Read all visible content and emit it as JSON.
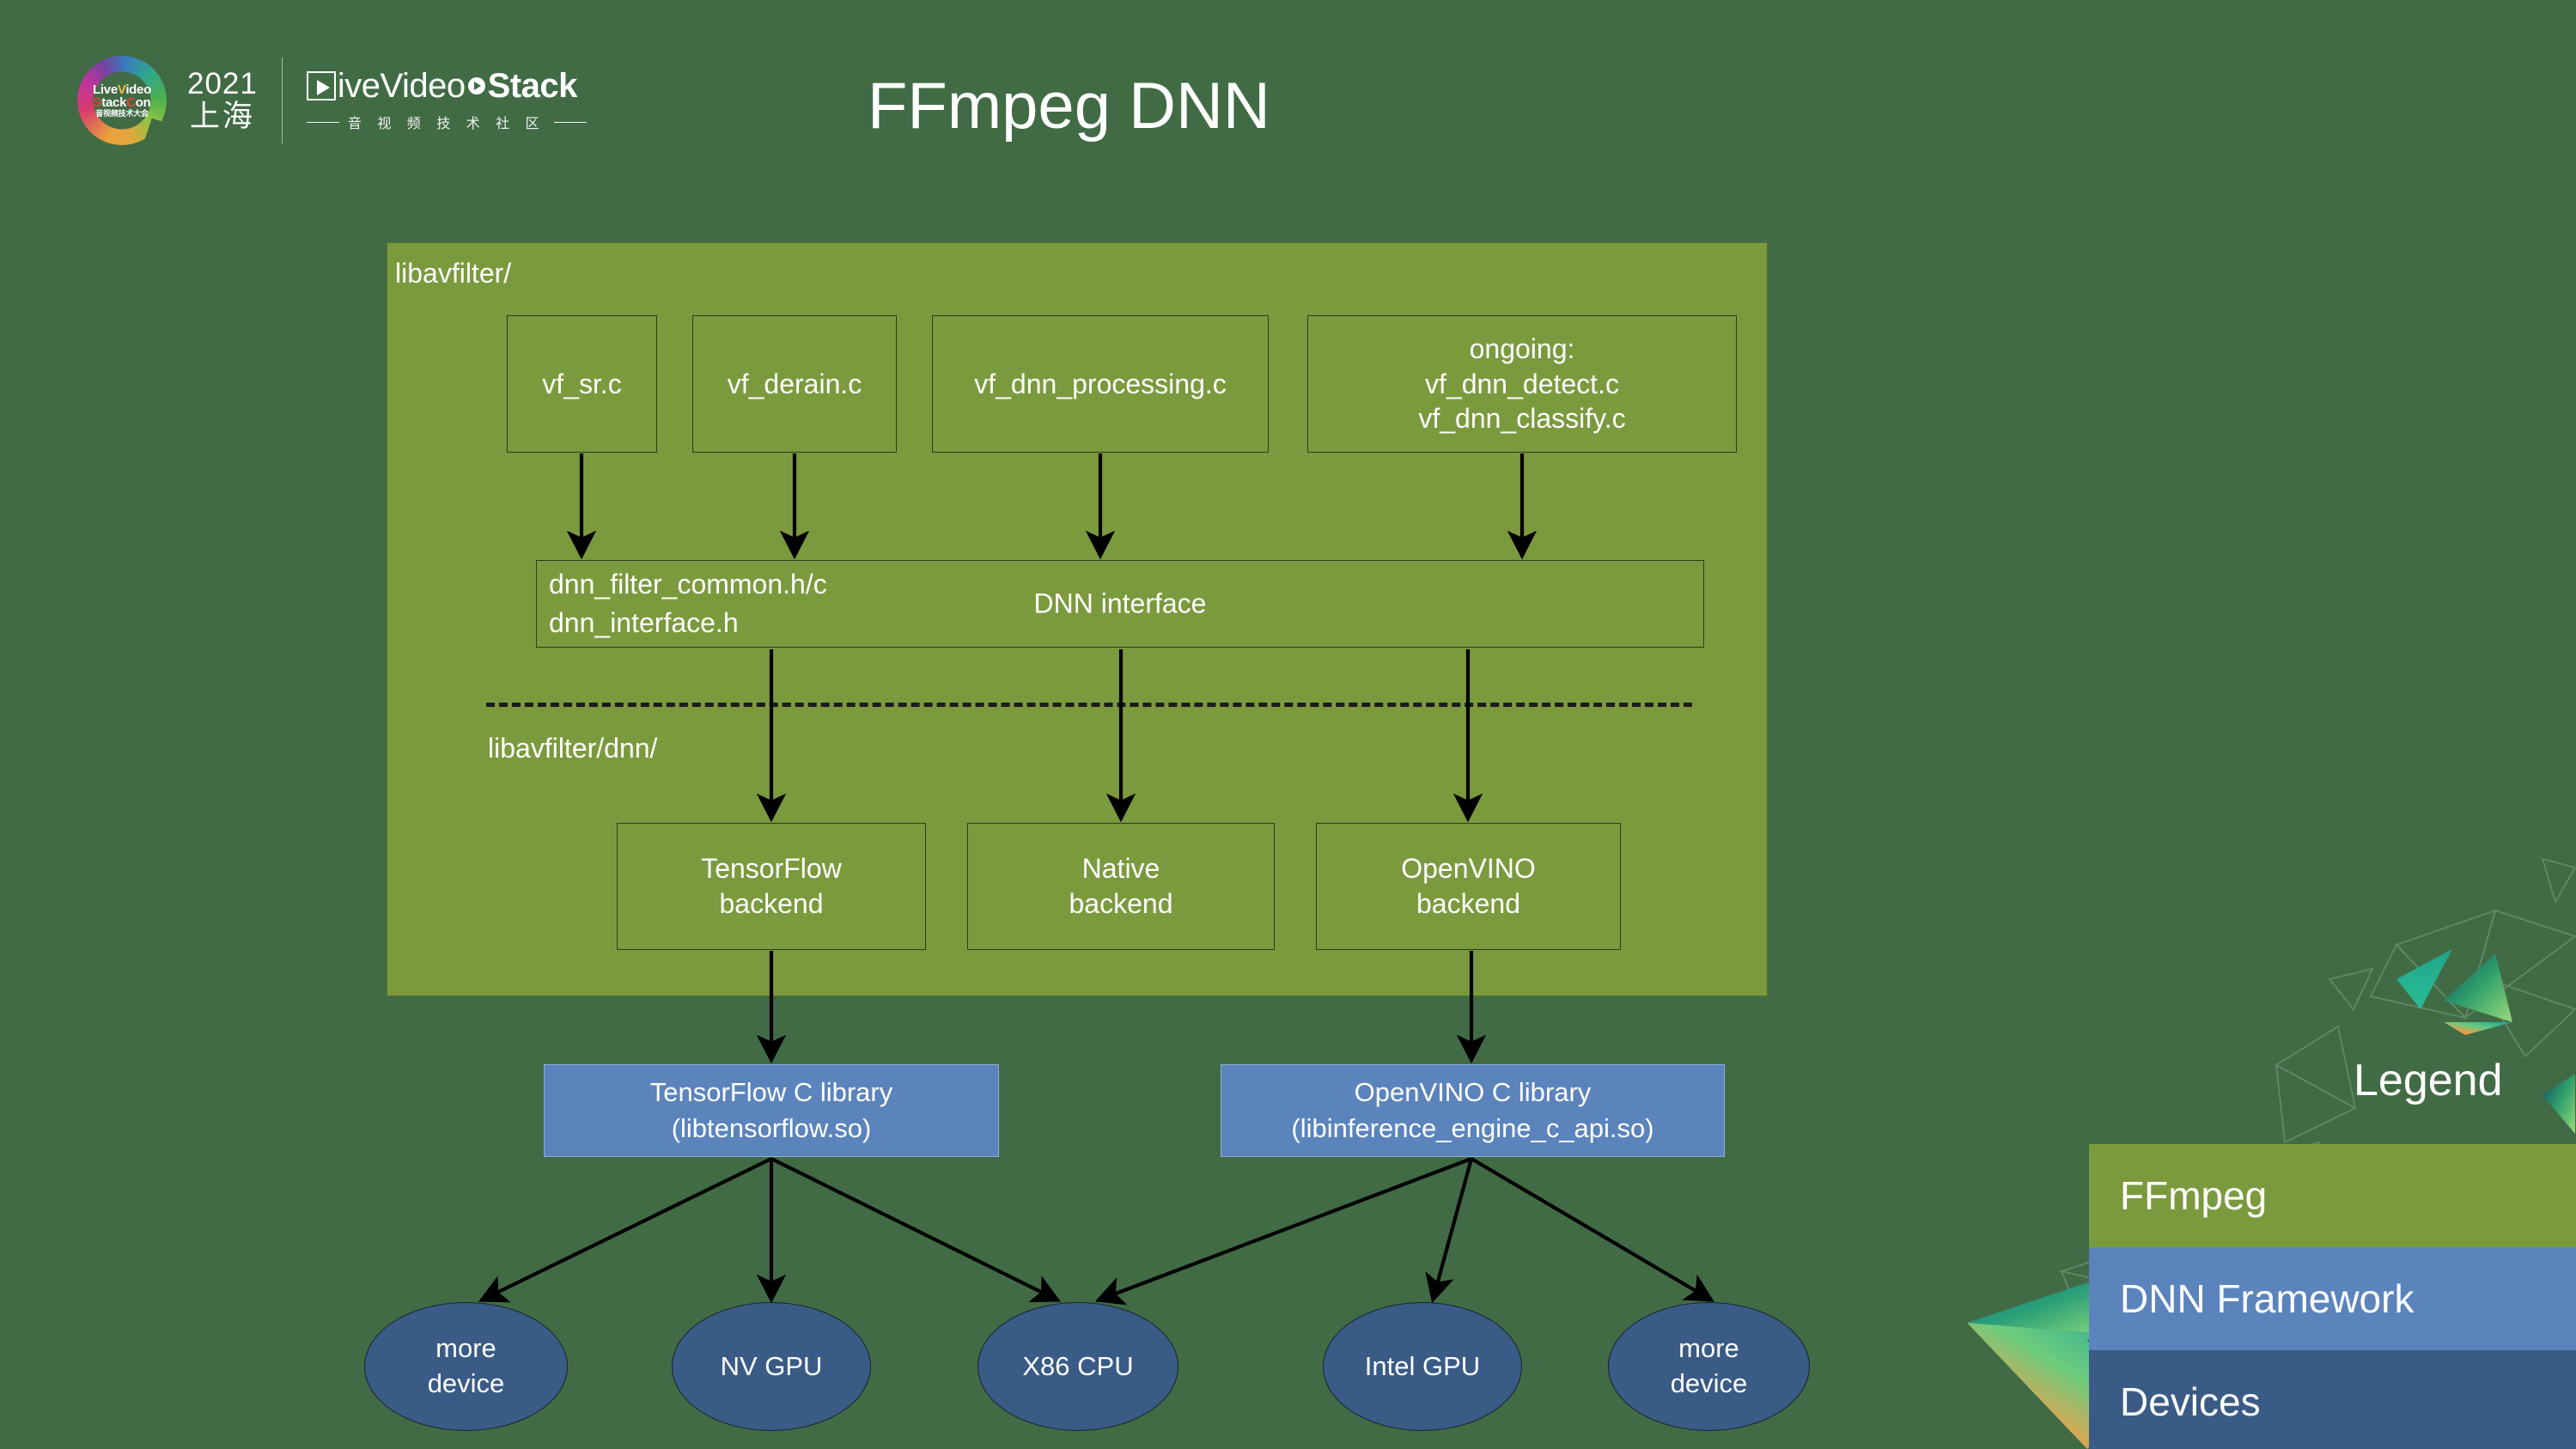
{
  "header": {
    "logo": {
      "ring_line1_a": "Live",
      "ring_line1_b": "V",
      "ring_line1_c": "ideo",
      "ring_line2_a": "S",
      "ring_line2_b": "tack",
      "ring_line2_c": "C",
      "ring_line2_d": "on",
      "ring_line3": "音视频技术大会",
      "year": "2021",
      "city": "上海",
      "brand_part1": "ive",
      "brand_part2": "Video",
      "brand_part3": "Stack",
      "brand_sub": "音 视 频 技 术 社 区"
    }
  },
  "title": "FFmpeg DNN",
  "panel": {
    "label_top": "libavfilter/",
    "label_dnn": "libavfilter/dnn/",
    "filters": [
      {
        "label": "vf_sr.c"
      },
      {
        "label": "vf_derain.c"
      },
      {
        "label": "vf_dnn_processing.c"
      },
      {
        "label": "ongoing:\nvf_dnn_detect.c\nvf_dnn_classify.c"
      }
    ],
    "interface": {
      "files": "dnn_filter_common.h/c\ndnn_interface.h",
      "label": "DNN interface"
    },
    "backends": [
      {
        "label": "TensorFlow\nbackend"
      },
      {
        "label": "Native\nbackend"
      },
      {
        "label": "OpenVINO\nbackend"
      }
    ]
  },
  "libraries": [
    {
      "label": "TensorFlow C library\n(libtensorflow.so)"
    },
    {
      "label": "OpenVINO C library\n(libinference_engine_c_api.so)"
    }
  ],
  "devices": [
    {
      "label": "more\ndevice"
    },
    {
      "label": "NV GPU"
    },
    {
      "label": "X86 CPU"
    },
    {
      "label": "Intel GPU"
    },
    {
      "label": "more\ndevice"
    }
  ],
  "legend": {
    "title": "Legend",
    "rows": [
      {
        "label": "FFmpeg",
        "color": "#7b9a3e"
      },
      {
        "label": "DNN Framework",
        "color": "#5b84bd"
      },
      {
        "label": "Devices",
        "color": "#395b85"
      }
    ]
  },
  "colors": {
    "background": "#416b45",
    "ffmpeg_green": "#7b9a3e",
    "framework_blue": "#5b84bd",
    "device_blue": "#395b85",
    "arrow": "#000000"
  }
}
